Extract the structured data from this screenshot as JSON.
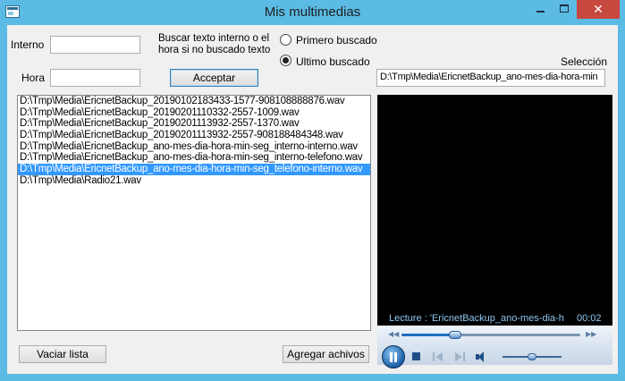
{
  "window": {
    "title": "Mis  multimedias"
  },
  "search": {
    "interno_label": "Interno",
    "interno_value": "",
    "hora_label": "Hora",
    "hora_value": "",
    "hint_line1": "Buscar texto interno o el",
    "hint_line2": "hora si no buscado texto",
    "accept_label": "Acceptar",
    "radio_first_label": "Primero  buscado",
    "radio_first_checked": false,
    "radio_last_label": "Ultimo  buscado",
    "radio_last_checked": true
  },
  "selection": {
    "label": "Selección",
    "value": "D:\\Tmp\\Media\\EricnetBackup_ano-mes-dia-hora-min"
  },
  "file_list": {
    "selected_index": 6,
    "items": [
      "D:\\Tmp\\Media\\EricnetBackup_20190102183433-1577-908108888876.wav",
      "D:\\Tmp\\Media\\EricnetBackup_20190201110332-2557-1009.wav",
      "D:\\Tmp\\Media\\EricnetBackup_20190201113932-2557-1370.wav",
      "D:\\Tmp\\Media\\EricnetBackup_20190201113932-2557-908188484348.wav",
      "D:\\Tmp\\Media\\EricnetBackup_ano-mes-dia-hora-min-seg_interno-interno.wav",
      "D:\\Tmp\\Media\\EricnetBackup_ano-mes-dia-hora-min-seg_interno-telefono.wav",
      "D:\\Tmp\\Media\\EricnetBackup_ano-mes-dia-hora-min-seg_telefono-interno.wav",
      "D:\\Tmp\\Media\\Radio21.wav"
    ]
  },
  "buttons": {
    "clear_label": "Vaciar lista",
    "add_label": "Agregar achivos"
  },
  "player": {
    "status_text": "Lecture : 'EricnetBackup_ano-mes-dia-hora-min-seg_telefono-interno.wav'",
    "time_text": "00:02",
    "seek_fraction": 0.3,
    "volume_fraction": 0.5
  },
  "icons": {
    "app": "media-app-icon",
    "minimize": "minimize-icon",
    "maximize": "maximize-icon",
    "close": "close-icon",
    "play_pause": "pause-icon",
    "stop": "stop-icon",
    "previous": "previous-icon",
    "next": "next-icon",
    "volume": "volume-icon",
    "close_glyph": "✕"
  },
  "colors": {
    "window_frame": "#5bbbe4",
    "close_button": "#c7483e",
    "list_selection": "#3399ff",
    "player_background": "#000000",
    "player_text": "#8ec6f0"
  }
}
